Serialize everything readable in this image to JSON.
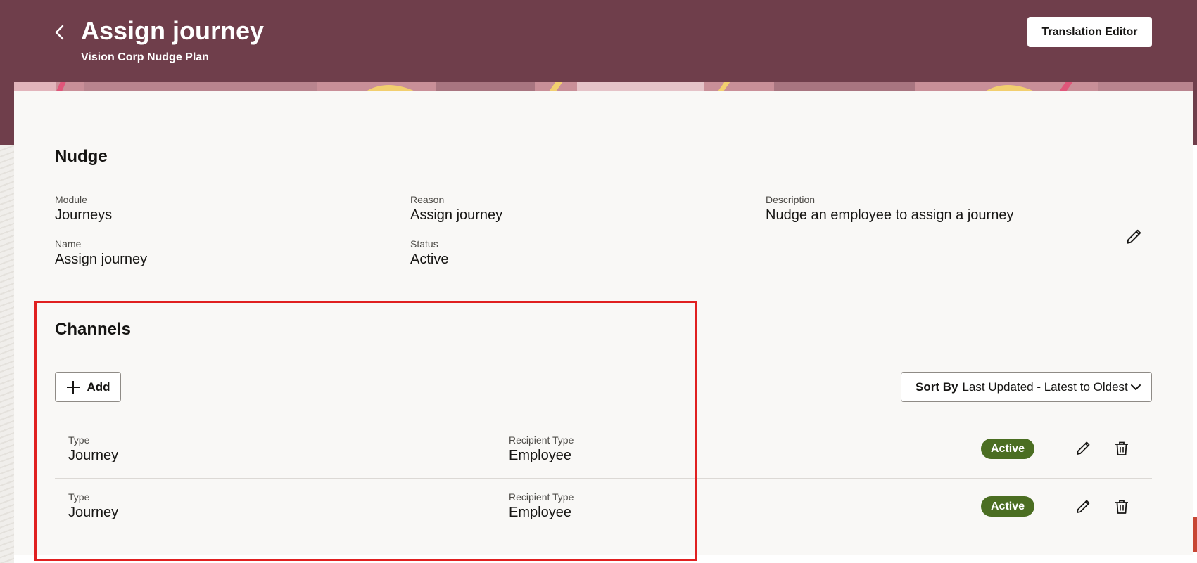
{
  "header": {
    "title": "Assign journey",
    "subtitle": "Vision Corp Nudge Plan",
    "translation_button": "Translation Editor",
    "back_icon": "chevron-left-icon",
    "background_color": "#6f3e4b"
  },
  "nudge": {
    "section_title": "Nudge",
    "fields": {
      "module": {
        "label": "Module",
        "value": "Journeys"
      },
      "reason": {
        "label": "Reason",
        "value": "Assign journey"
      },
      "description": {
        "label": "Description",
        "value": "Nudge an employee to assign a journey"
      },
      "name": {
        "label": "Name",
        "value": "Assign journey"
      },
      "status": {
        "label": "Status",
        "value": "Active"
      }
    },
    "edit_icon": "pencil-icon"
  },
  "channels": {
    "section_title": "Channels",
    "add_button": "Add",
    "add_icon": "plus-icon",
    "sort": {
      "label": "Sort By",
      "value": "Last Updated - Latest to Oldest",
      "icon": "chevron-down-icon"
    },
    "rows": [
      {
        "type_label": "Type",
        "type_value": "Journey",
        "recipient_label": "Recipient Type",
        "recipient_value": "Employee",
        "status": "Active"
      },
      {
        "type_label": "Type",
        "type_value": "Journey",
        "recipient_label": "Recipient Type",
        "recipient_value": "Employee",
        "status": "Active"
      }
    ],
    "row_icons": [
      "pencil-icon",
      "trash-icon"
    ]
  },
  "colors": {
    "status_active": "#4b6e22",
    "highlight": "#e02020",
    "card_background": "#f9f8f6"
  }
}
